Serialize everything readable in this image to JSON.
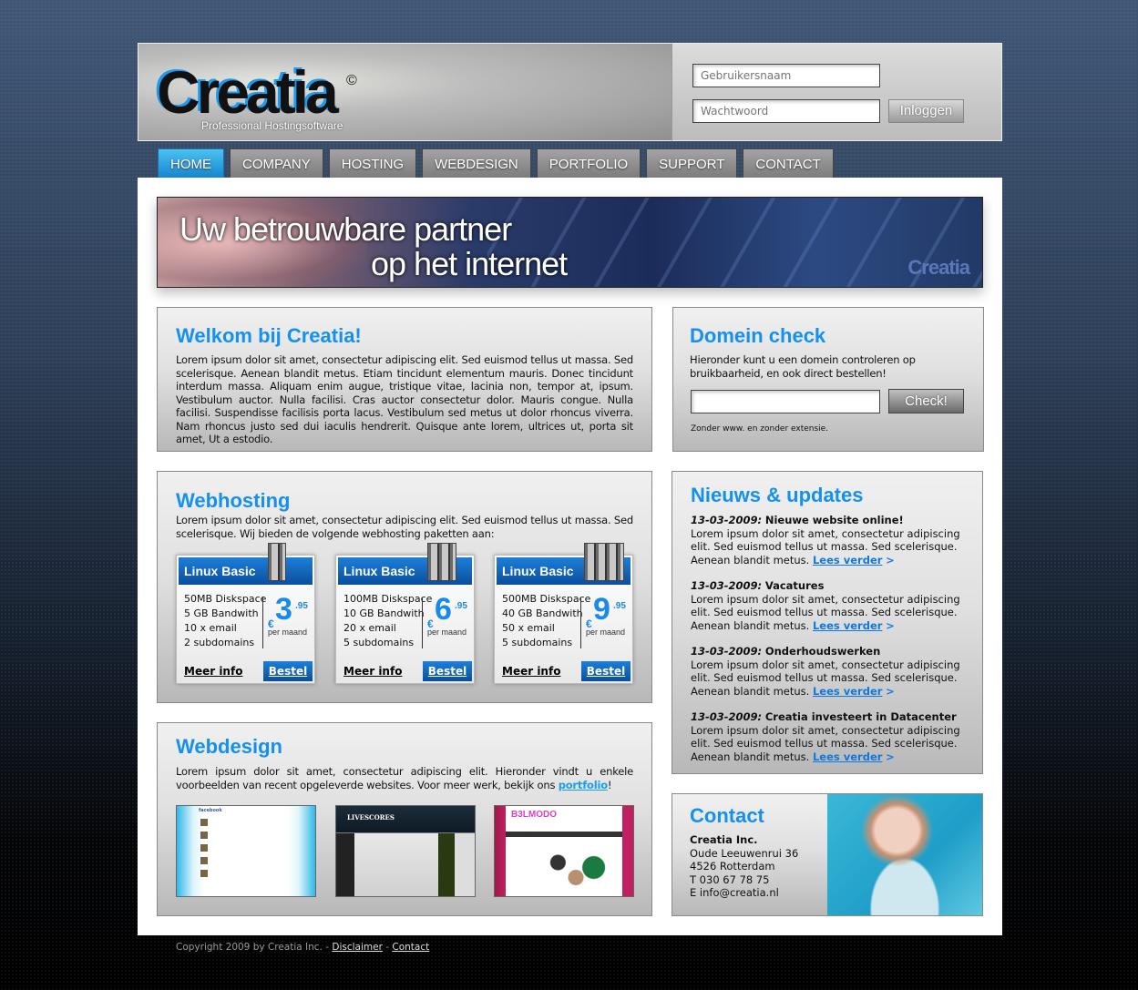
{
  "header": {
    "logo_text": "Creatia",
    "logo_mark": "©",
    "tagline": "Professional Hostingsoftware",
    "username_placeholder": "Gebruikersnaam",
    "password_placeholder": "Wachtwoord",
    "login_button": "Inloggen"
  },
  "nav": {
    "items": [
      {
        "label": "HOME",
        "active": true
      },
      {
        "label": "COMPANY"
      },
      {
        "label": "HOSTING"
      },
      {
        "label": "WEBDESIGN"
      },
      {
        "label": "PORTFOLIO"
      },
      {
        "label": "SUPPORT"
      },
      {
        "label": "CONTACT"
      }
    ]
  },
  "banner": {
    "line1": "Uw betrouwbare partner",
    "line2": "op het internet",
    "brand": "Creatia"
  },
  "welcome": {
    "title": "Welkom bij Creatia!",
    "text": "Lorem ipsum dolor sit amet, consectetur adipiscing elit. Sed euismod tellus ut massa. Sed scelerisque. Aenean blandit metus. Etiam tincidunt elementum mauris. Donec tincidunt interdum massa. Aliquam enim augue, tristique vitae, lacinia non, tempor at, ipsum. Vestibulum auctor. Nulla facilisi. Cras auctor consectetur dolor. Mauris congue. Nulla facilisi. Suspendisse facilisis porta lacus. Vestibulum sed metus ut dolor rhoncus viverra. Nam rhoncus justo sed dui iaculis hendrerit. Quisque ante lorem, ultrices ut, porta sit amet, Ut a estodio."
  },
  "domain": {
    "title": "Domein check",
    "text": "Hieronder kunt u een domein controleren op bruikbaarheid, en ook direct bestellen!",
    "input_value": "",
    "button": "Check!",
    "hint": "Zonder www. en zonder extensie."
  },
  "webhosting": {
    "title": "Webhosting",
    "text": "Lorem ipsum dolor sit amet, consectetur adipiscing elit. Sed euismod tellus ut massa. Sed scelerisque. Wij bieden de volgende webhosting paketten aan:",
    "packages": [
      {
        "name": "Linux Basic",
        "features": [
          "50MB Diskspace",
          "5 GB Bandwith",
          "10 x email",
          "2 subdomains"
        ],
        "currency": "€",
        "price": "3",
        "cents": ".95",
        "period": "per maand",
        "more": "Meer info",
        "order": "Bestel"
      },
      {
        "name": "Linux Basic",
        "features": [
          "100MB Diskspace",
          "10 GB Bandwith",
          "20 x email",
          "5 subdomains"
        ],
        "currency": "€",
        "price": "6",
        "cents": ".95",
        "period": "per maand",
        "more": "Meer info",
        "order": "Bestel"
      },
      {
        "name": "Linux Basic",
        "features": [
          "500MB Diskspace",
          "40 GB Bandwith",
          "50 x email",
          "5 subdomains"
        ],
        "currency": "€",
        "price": "9",
        "cents": ".95",
        "period": "per maand",
        "more": "Meer info",
        "order": "Bestel"
      }
    ]
  },
  "webdesign": {
    "title": "Webdesign",
    "text_before": "Lorem ipsum dolor sit amet, consectetur adipiscing elit. Hieronder vindt u enkele voorbeelden van recent opgeleverde websites. Voor meer werk, bekijk ons ",
    "link": "portfolio",
    "text_after": "!",
    "thumbs": [
      "facebook",
      "LIVESCORES",
      "B3LMODO"
    ]
  },
  "news": {
    "title": "Nieuws & updates",
    "items": [
      {
        "date": "13-03-2009:",
        "title": "Nieuwe website online!",
        "text": "Lorem ipsum dolor sit amet, consectetur adipiscing elit. Sed euismod tellus ut massa. Sed scelerisque. Aenean blandit metus. ",
        "link": "Lees verder",
        "arrow": ">"
      },
      {
        "date": "13-03-2009:",
        "title": "Vacatures",
        "text": "Lorem ipsum dolor sit amet, consectetur adipiscing elit. Sed euismod tellus ut massa. Sed scelerisque. Aenean blandit metus. ",
        "link": "Lees verder",
        "arrow": ">"
      },
      {
        "date": "13-03-2009:",
        "title": "Onderhoudswerken",
        "text": "Lorem ipsum dolor sit amet, consectetur adipiscing elit. Sed euismod tellus ut massa. Sed scelerisque. Aenean blandit metus. ",
        "link": "Lees verder",
        "arrow": ">"
      },
      {
        "date": "13-03-2009:",
        "title": "Creatia investeert in Datacenter",
        "text": "Lorem ipsum dolor sit amet, consectetur adipiscing elit. Sed euismod tellus ut massa. Sed scelerisque. Aenean blandit metus. ",
        "link": "Lees verder",
        "arrow": ">"
      }
    ]
  },
  "contact": {
    "title": "Contact",
    "company": "Creatia Inc.",
    "address": "Oude Leeuwenrui 36",
    "city": "4526 Rotterdam",
    "phone": "T 030 67 78 75",
    "email": "E info@creatia.nl"
  },
  "footer": {
    "copyright": "Copyright 2009 by Creatia Inc. - ",
    "disclaimer": "Disclaimer",
    "sep": " - ",
    "contact": "Contact"
  },
  "colors": {
    "accent": "#1491ee",
    "nav_active": "#2aa6e8",
    "package_blue": "#0d5fb3"
  }
}
